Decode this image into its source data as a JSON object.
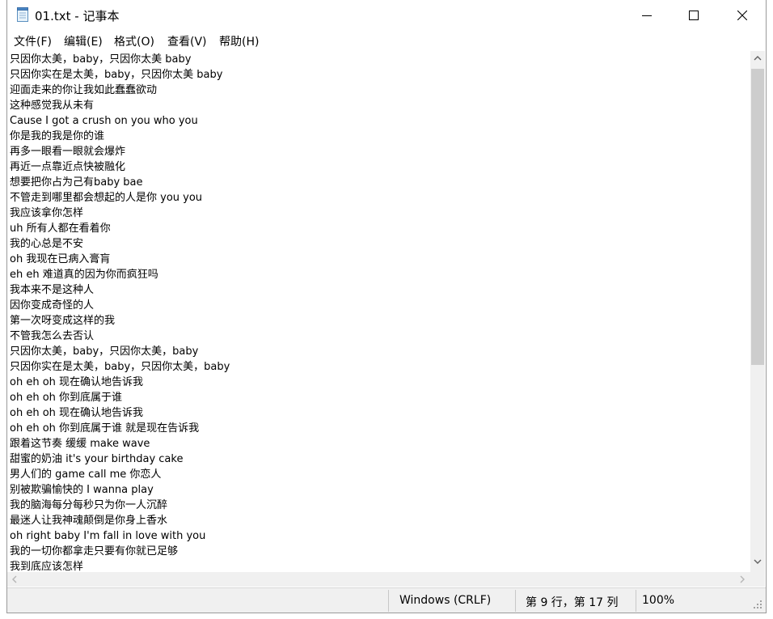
{
  "window": {
    "title": "01.txt - 记事本",
    "controls": {
      "minimize_icon": "minimize-icon",
      "maximize_icon": "maximize-icon",
      "close_icon": "close-icon"
    }
  },
  "menu": [
    {
      "label": "文件(F)"
    },
    {
      "label": "编辑(E)"
    },
    {
      "label": "格式(O)"
    },
    {
      "label": "查看(V)"
    },
    {
      "label": "帮助(H)"
    }
  ],
  "editor": {
    "lines": [
      "只因你太美，baby，只因你太美 baby",
      "只因你实在是太美，baby，只因你太美 baby",
      "迎面走来的你让我如此蠢蠢欲动",
      "这种感觉我从未有",
      "Cause I got a crush on you who you",
      "你是我的我是你的谁",
      "再多一眼看一眼就会爆炸",
      "再近一点靠近点快被融化",
      "想要把你占为己有baby bae",
      "不管走到哪里都会想起的人是你 you you",
      "我应该拿你怎样",
      "uh 所有人都在看着你",
      "我的心总是不安",
      "oh 我现在已病入膏肓",
      "eh eh 难道真的因为你而疯狂吗",
      "我本来不是这种人",
      "因你变成奇怪的人",
      "第一次呀变成这样的我",
      "不管我怎么去否认",
      "只因你太美，baby，只因你太美，baby",
      "只因你实在是太美，baby，只因你太美，baby",
      "oh eh oh 现在确认地告诉我",
      "oh eh oh 你到底属于谁",
      "oh eh oh 现在确认地告诉我",
      "oh eh oh 你到底属于谁 就是现在告诉我",
      "跟着这节奏 缓缓 make wave",
      "甜蜜的奶油 it's your birthday cake",
      "男人们的 game call me 你恋人",
      "别被欺骗愉快的 I wanna play",
      "我的脑海每分每秒只为你一人沉醉",
      "最迷人让我神魂颠倒是你身上香水",
      "oh right baby I'm fall in love with you",
      "我的一切你都拿走只要有你就已足够",
      "我到底应该怎样"
    ]
  },
  "statusbar": {
    "encoding": "Windows (CRLF)",
    "position": "第 9 行，第 17 列",
    "zoom": "100%"
  },
  "colors": {
    "chrome": "#f0f0f0",
    "scroll_thumb": "#cdcdcd",
    "text": "#000000"
  }
}
